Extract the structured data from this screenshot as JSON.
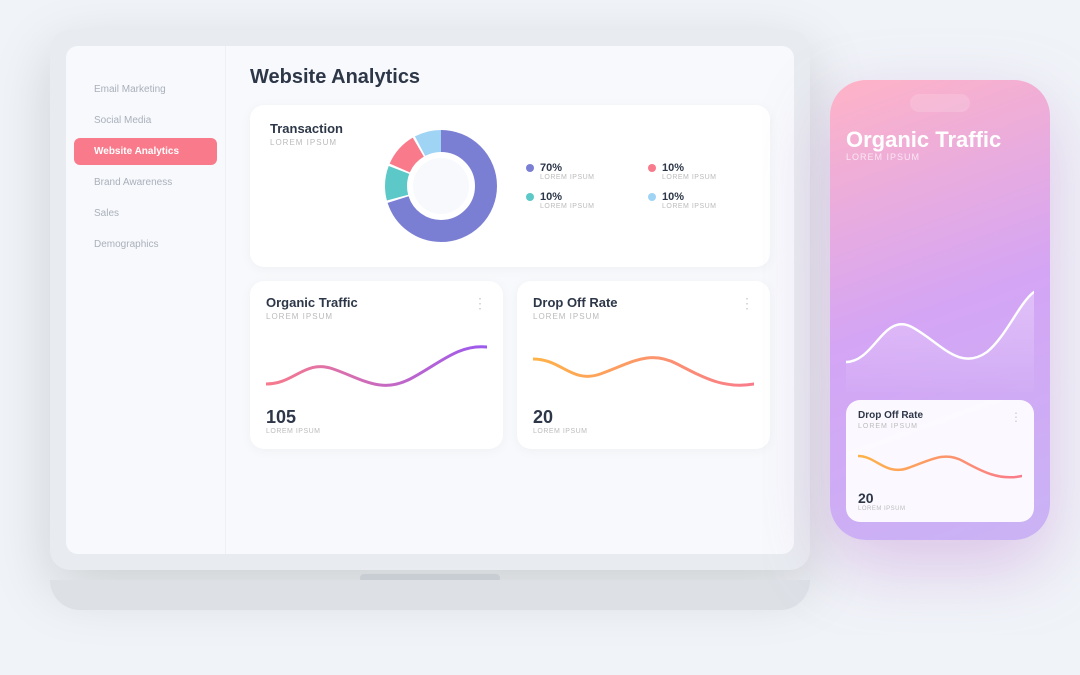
{
  "page": {
    "bg_color": "#f0f4f8"
  },
  "sidebar": {
    "items": [
      {
        "label": "Email Marketing",
        "active": false
      },
      {
        "label": "Social Media",
        "active": false
      },
      {
        "label": "Website Analytics",
        "active": true
      },
      {
        "label": "Brand Awareness",
        "active": false
      },
      {
        "label": "Sales",
        "active": false
      },
      {
        "label": "Demographics",
        "active": false
      }
    ]
  },
  "main": {
    "title": "Website Analytics",
    "transaction_card": {
      "title": "Transaction",
      "subtitle": "LOREM IPSUM",
      "legend": [
        {
          "pct": "70%",
          "label": "LOREM IPSUM",
          "color": "#7b7fd4"
        },
        {
          "pct": "10%",
          "label": "LOREM IPSUM",
          "color": "#f97b8b"
        },
        {
          "pct": "10%",
          "label": "LOREM IPSUM",
          "color": "#5cc8c8"
        },
        {
          "pct": "10%",
          "label": "LOREM IPSUM",
          "color": "#a0d4f5"
        }
      ]
    },
    "organic_traffic_card": {
      "title": "Organic Traffic",
      "subtitle": "LOREM IPSUM",
      "value": "105",
      "value_label": "LOREM IPSUM",
      "dots_menu": "⋮"
    },
    "drop_off_card": {
      "title": "Drop Off Rate",
      "subtitle": "LOREM IPSUM",
      "value": "20",
      "value_label": "LOREM IPSUM",
      "dots_menu": "⋮"
    }
  },
  "phone": {
    "title": "Organic Traffic",
    "subtitle": "LOREM IPSUM",
    "bottom_card": {
      "title": "Drop Off Rate",
      "subtitle": "LOREM IPSUM",
      "value": "20",
      "value_label": "LOREM IPSUM",
      "dots_menu": "⋮"
    }
  },
  "donut": {
    "segments": [
      {
        "color": "#7b7fd4",
        "pct": 70
      },
      {
        "color": "#5cc8c8",
        "pct": 10
      },
      {
        "color": "#f97b8b",
        "pct": 10
      },
      {
        "color": "#a0d4f5",
        "pct": 10
      }
    ]
  }
}
